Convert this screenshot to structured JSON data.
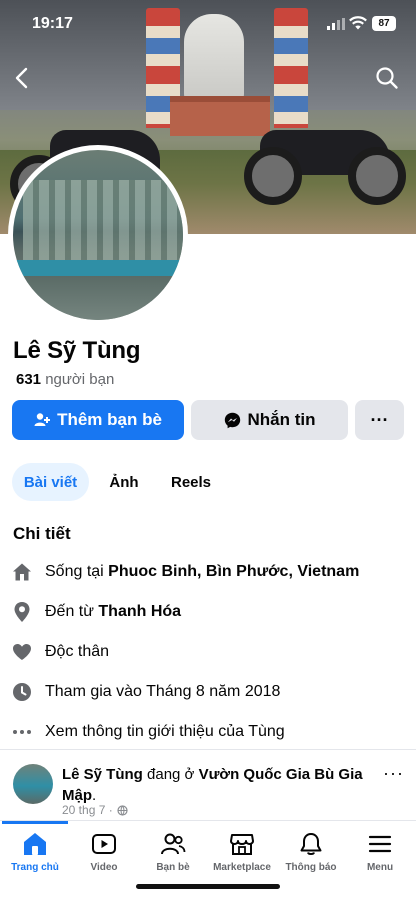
{
  "status_bar": {
    "time": "19:17",
    "battery": "87"
  },
  "profile": {
    "name": "Lê Sỹ Tùng",
    "friends_count": "631",
    "friends_label": "người bạn"
  },
  "actions": {
    "add_friend": "Thêm bạn bè",
    "message": "Nhắn tin",
    "more": "···"
  },
  "tabs": [
    {
      "label": "Bài viết",
      "active": true
    },
    {
      "label": "Ảnh",
      "active": false
    },
    {
      "label": "Reels",
      "active": false
    }
  ],
  "details": {
    "title": "Chi tiết",
    "lives_prefix": "Sống tại ",
    "lives_place": "Phuoc Binh, Bìn Phước, Vietnam",
    "from_prefix": "Đến từ ",
    "from_place": "Thanh Hóa",
    "relationship": "Độc thân",
    "joined": "Tham gia vào Tháng 8 năm 2018",
    "see_more": "Xem thông tin giới thiệu của Tùng"
  },
  "post": {
    "author": "Lê Sỹ Tùng",
    "middle": " đang ở ",
    "place": "Vườn Quốc Gia Bù Gia Mập",
    "end": ".",
    "date": "20 thg 7 ·",
    "more": "···"
  },
  "bottom_nav": [
    {
      "label": "Trang chủ",
      "icon": "home-icon",
      "active": true
    },
    {
      "label": "Video",
      "icon": "video-icon",
      "active": false
    },
    {
      "label": "Bạn bè",
      "icon": "friends-icon",
      "active": false
    },
    {
      "label": "Marketplace",
      "icon": "marketplace-icon",
      "active": false
    },
    {
      "label": "Thông báo",
      "icon": "bell-icon",
      "active": false
    },
    {
      "label": "Menu",
      "icon": "menu-icon",
      "active": false
    }
  ],
  "colors": {
    "accent": "#1877f2",
    "button_gray": "#e4e6eb",
    "secondary_text": "#65676b"
  }
}
